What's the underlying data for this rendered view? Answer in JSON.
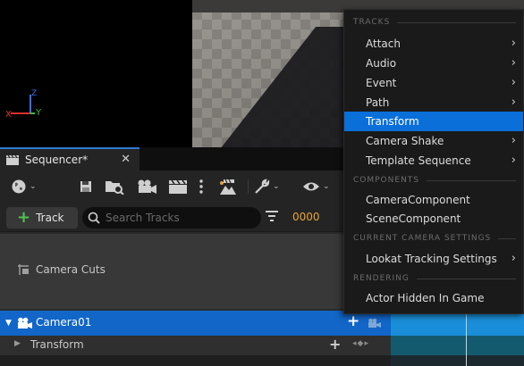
{
  "sequencer": {
    "tab_label": "Sequencer*",
    "close_glyph": "✕"
  },
  "toolbar": {
    "icons": [
      "world-icon",
      "save-icon",
      "find-in-browser-icon",
      "camera-icon",
      "clapperboard-icon",
      "more-icon",
      "render-movie-icon",
      "wrench-icon",
      "eye-icon"
    ]
  },
  "search": {
    "add_track_label": "Track",
    "placeholder": "Search Tracks",
    "frame_value": "0000"
  },
  "tracks": {
    "camera_cuts_label": "Camera Cuts",
    "camera_label": "Camera01",
    "transform_label": "Transform"
  },
  "menu": {
    "sections": {
      "tracks": "TRACKS",
      "components": "COMPONENTS",
      "camera_settings": "CURRENT CAMERA SETTINGS",
      "rendering": "RENDERING"
    },
    "items": {
      "attach": "Attach",
      "audio": "Audio",
      "event": "Event",
      "path": "Path",
      "transform": "Transform",
      "camera_shake": "Camera Shake",
      "template_sequence": "Template Sequence",
      "camera_component": "CameraComponent",
      "scene_component": "SceneComponent",
      "lookat_tracking": "Lookat Tracking Settings",
      "actor_hidden": "Actor Hidden In Game"
    },
    "highlighted": "Transform"
  },
  "axis": {
    "x_label": "X",
    "y_label": "Y",
    "z_label": "Z"
  },
  "colors": {
    "accent": "#0a6fd8",
    "selection_row": "#1166c8",
    "frame_number": "#e8a43a",
    "add_green": "#4fc34f"
  }
}
